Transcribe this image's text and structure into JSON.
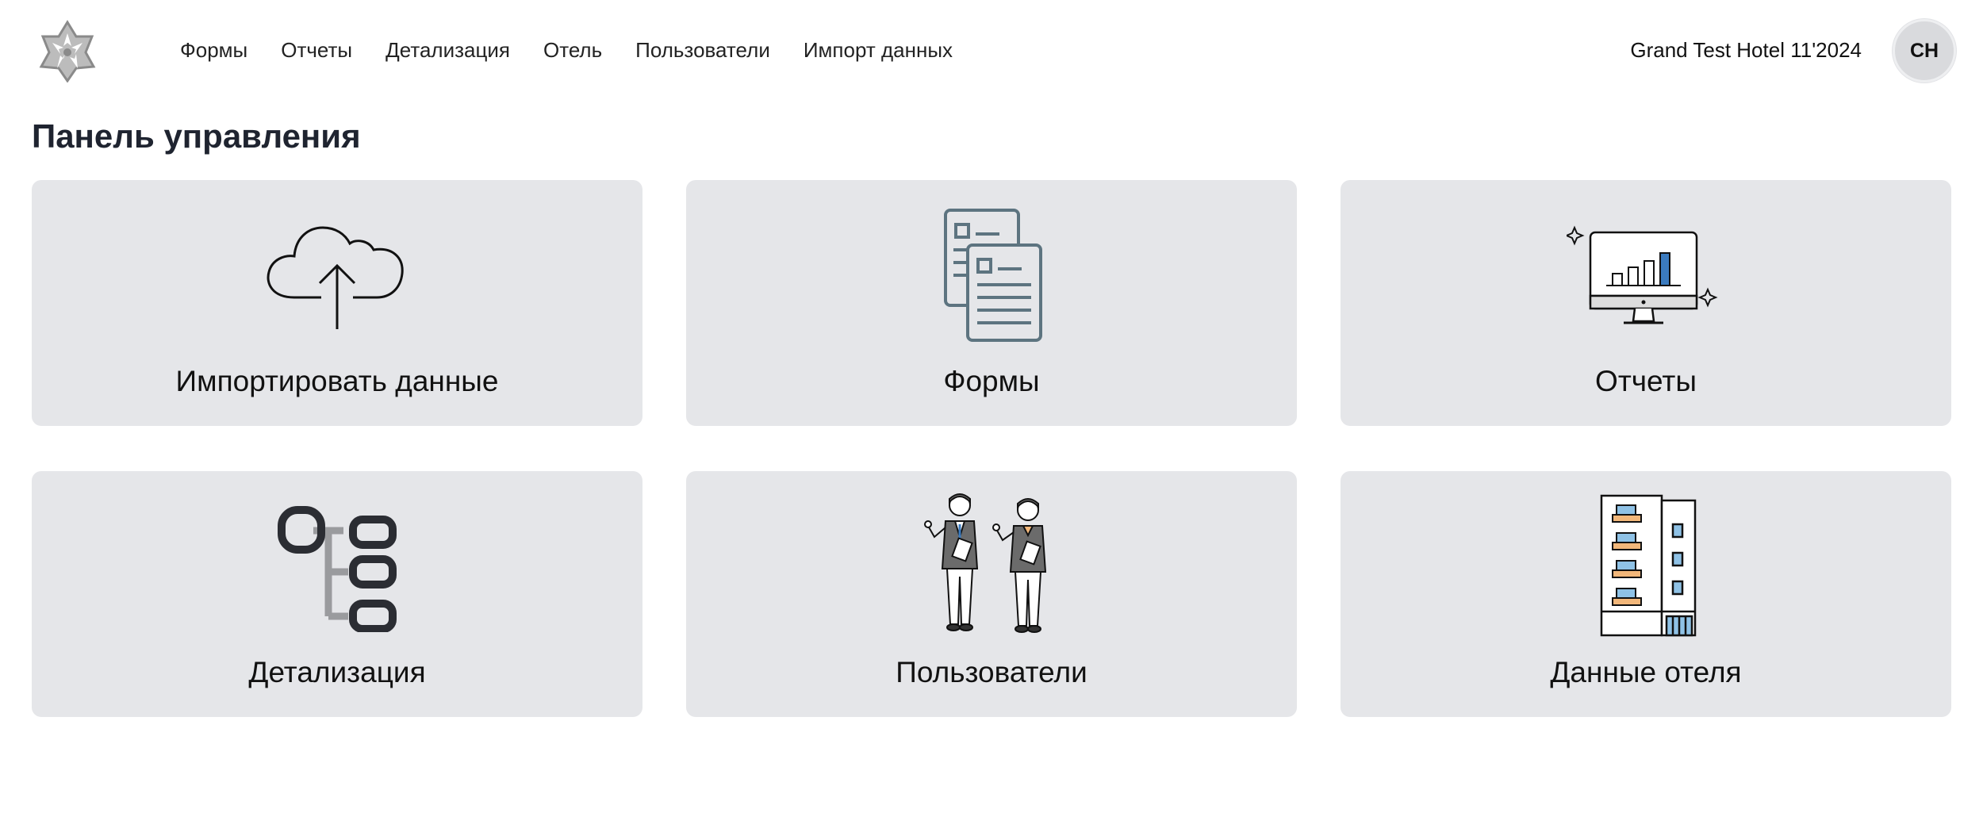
{
  "header": {
    "logo_icon": "star-burst-logo-icon",
    "nav": [
      {
        "label": "Формы"
      },
      {
        "label": "Отчеты"
      },
      {
        "label": "Детализация"
      },
      {
        "label": "Отель"
      },
      {
        "label": "Пользователи"
      },
      {
        "label": "Импорт данных"
      }
    ],
    "hotel_name": "Grand Test Hotel 11'2024",
    "avatar_initials": "CH"
  },
  "main": {
    "title": "Панель управления",
    "cards": [
      {
        "label": "Импортировать данные",
        "icon": "cloud-upload-icon"
      },
      {
        "label": "Формы",
        "icon": "documents-icon"
      },
      {
        "label": "Отчеты",
        "icon": "monitor-bar-chart-icon"
      },
      {
        "label": "Детализация",
        "icon": "tree-structure-icon"
      },
      {
        "label": "Пользователи",
        "icon": "users-people-icon"
      },
      {
        "label": "Данные отеля",
        "icon": "hotel-building-icon"
      }
    ]
  },
  "colors": {
    "card_bg": "#e5e6e9",
    "title": "#1f2430",
    "accent_blue": "#3b7bbf",
    "accent_orange": "#f2b77a"
  }
}
